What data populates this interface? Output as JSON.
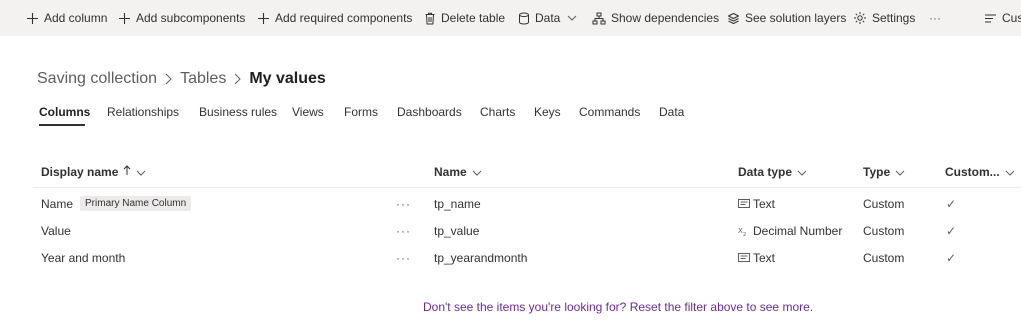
{
  "commandbar": {
    "add_column": "Add column",
    "add_subcomponents": "Add subcomponents",
    "add_required": "Add required components",
    "delete_table": "Delete table",
    "data": "Data",
    "show_dependencies": "Show dependencies",
    "see_solution_layers": "See solution layers",
    "settings": "Settings",
    "overflow": "···",
    "customize_truncated": "Cus"
  },
  "breadcrumb": {
    "root": "Saving collection",
    "tables": "Tables",
    "current": "My values"
  },
  "tabs": [
    "Columns",
    "Relationships",
    "Business rules",
    "Views",
    "Forms",
    "Dashboards",
    "Charts",
    "Keys",
    "Commands",
    "Data"
  ],
  "active_tab": "Columns",
  "table": {
    "headers": {
      "display_name": "Display name",
      "name": "Name",
      "data_type": "Data type",
      "type": "Type",
      "customizable": "Custom..."
    },
    "rows": [
      {
        "display_name": "Name",
        "badge": "Primary Name Column",
        "more": "···",
        "name": "tp_name",
        "data_type": "Text",
        "type": "Custom",
        "custom": "✓"
      },
      {
        "display_name": "Value",
        "badge": "",
        "more": "···",
        "name": "tp_value",
        "data_type": "Decimal Number",
        "type": "Custom",
        "custom": "✓"
      },
      {
        "display_name": "Year and month",
        "badge": "",
        "more": "···",
        "name": "tp_yearandmonth",
        "data_type": "Text",
        "type": "Custom",
        "custom": "✓"
      }
    ]
  },
  "footer": {
    "message": "Don't see the items you're looking for? Reset the filter above to see more."
  },
  "colors": {
    "command_bar_bg": "#f3f2f1",
    "link_purple": "#6b2c91",
    "text": "#323130"
  }
}
